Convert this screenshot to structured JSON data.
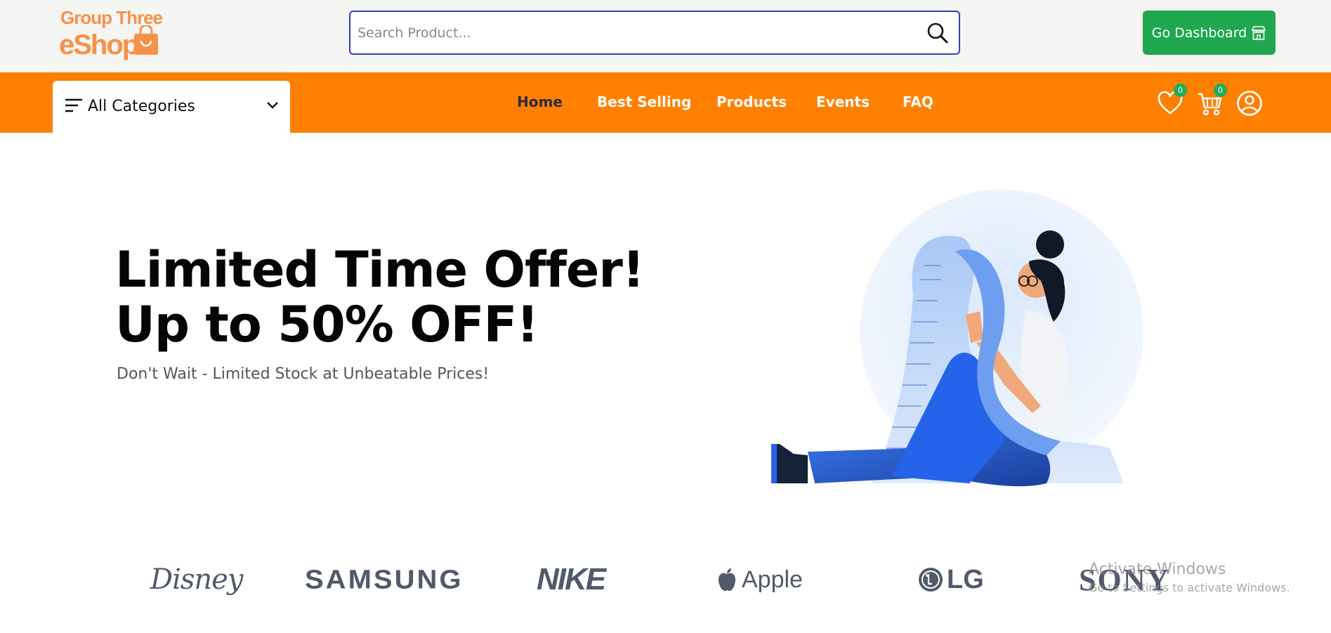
{
  "header": {
    "logo": {
      "line1": "Group Three",
      "line2": "eShop"
    },
    "search": {
      "placeholder": "Search Product...",
      "value": ""
    },
    "dashboard_button": {
      "label": "Go Dashboard",
      "icon": "store-icon"
    }
  },
  "navbar": {
    "categories": {
      "label": "All Categories",
      "icon": "menu-icon"
    },
    "links": [
      {
        "label": "Home",
        "active": true
      },
      {
        "label": "Best Selling",
        "active": false
      },
      {
        "label": "Products",
        "active": false
      },
      {
        "label": "Events",
        "active": false
      },
      {
        "label": "FAQ",
        "active": false
      }
    ],
    "wishlist": {
      "icon": "heart-icon",
      "count": "0"
    },
    "cart": {
      "icon": "cart-icon",
      "count": "0"
    },
    "profile": {
      "icon": "user-icon"
    }
  },
  "hero": {
    "title_line1": "Limited Time Offer!",
    "title_line2": "Up to 50% OFF!",
    "subtitle": "Don't Wait - Limited Stock at Unbeatable Prices!"
  },
  "brands": [
    "Disney",
    "SAMSUNG",
    "NIKE",
    "Apple",
    "LG",
    "SONY"
  ],
  "os_watermark": {
    "title": "Activate Windows",
    "subtitle": "Go to Settings to activate Windows."
  },
  "colors": {
    "primary_orange": "#ff8000",
    "dashboard_green": "#1fa84f",
    "badge_green": "#1fae5a",
    "search_border": "#3241b8"
  }
}
